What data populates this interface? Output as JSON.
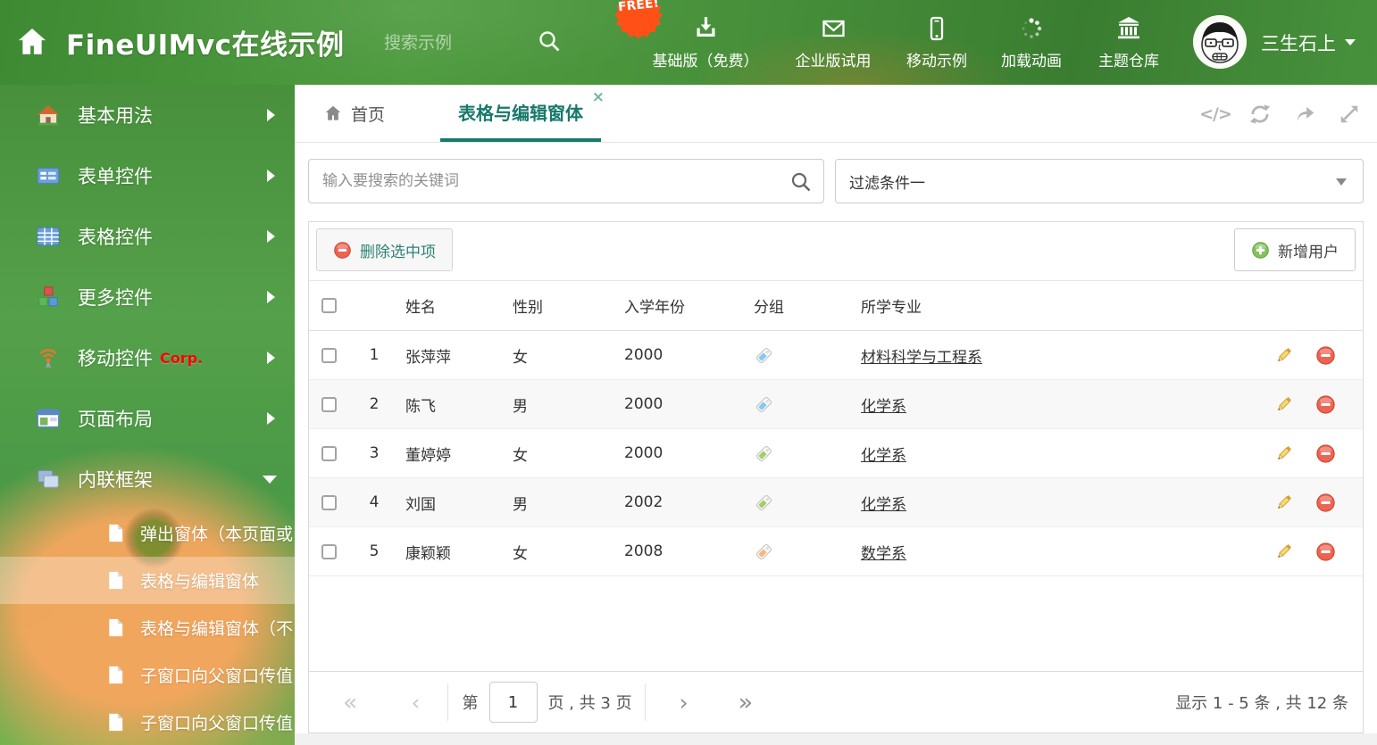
{
  "header": {
    "title": "FineUIMvc在线示例",
    "search_placeholder": "搜索示例",
    "free_badge": "FREE!",
    "nav": [
      {
        "label": "基础版（免费）"
      },
      {
        "label": "企业版试用"
      },
      {
        "label": "移动示例"
      },
      {
        "label": "加载动画"
      },
      {
        "label": "主题仓库"
      }
    ],
    "username": "三生石上"
  },
  "sidebar": {
    "items": [
      {
        "label": "基本用法"
      },
      {
        "label": "表单控件"
      },
      {
        "label": "表格控件"
      },
      {
        "label": "更多控件"
      },
      {
        "label": "移动控件",
        "badge": "Corp."
      },
      {
        "label": "页面布局"
      },
      {
        "label": "内联框架"
      }
    ],
    "subitems": [
      {
        "label": "弹出窗体（本页面或..."
      },
      {
        "label": "表格与编辑窗体"
      },
      {
        "label": "表格与编辑窗体（不..."
      },
      {
        "label": "子窗口向父窗口传值"
      },
      {
        "label": "子窗口向父窗口传值..."
      }
    ]
  },
  "tabs": {
    "home_label": "首页",
    "active_label": "表格与编辑窗体"
  },
  "filter": {
    "search_placeholder": "输入要搜索的关键词",
    "selected": "过滤条件一"
  },
  "grid_toolbar": {
    "delete_label": "删除选中项",
    "add_label": "新增用户"
  },
  "table": {
    "columns": {
      "name": "姓名",
      "gender": "性别",
      "year": "入学年份",
      "group": "分组",
      "major": "所学专业"
    },
    "rows": [
      {
        "index": "1",
        "name": "张萍萍",
        "gender": "女",
        "year": "2000",
        "tag_color": "#85C8F2",
        "major": "材料科学与工程系"
      },
      {
        "index": "2",
        "name": "陈飞",
        "gender": "男",
        "year": "2000",
        "tag_color": "#85C8F2",
        "major": "化学系"
      },
      {
        "index": "3",
        "name": "董婷婷",
        "gender": "女",
        "year": "2000",
        "tag_color": "#A5CE6B",
        "major": "化学系"
      },
      {
        "index": "4",
        "name": "刘国",
        "gender": "男",
        "year": "2002",
        "tag_color": "#A5CE6B",
        "major": "化学系"
      },
      {
        "index": "5",
        "name": "康颖颖",
        "gender": "女",
        "year": "2008",
        "tag_color": "#F9B97C",
        "major": "数学系"
      }
    ]
  },
  "pagination": {
    "page_prefix": "第",
    "page_value": "1",
    "page_suffix": "页 , 共 3 页",
    "summary": "显示 1 - 5 条 , 共 12 条"
  },
  "icons": {
    "close_glyph": "×",
    "code_glyph": "</>",
    "first_glyph": "«",
    "prev_glyph": "‹",
    "next_glyph": "›",
    "last_glyph": "»"
  },
  "colors": {
    "accent": "#17796A",
    "header_green": "#47903C",
    "corp_red": "#FF0000",
    "free_badge": "#FF5117",
    "delete_red": "#E9573F",
    "add_green": "#71B84E",
    "pencil_gold": "#F0C75A",
    "tag_blue": "#85C8F2",
    "tag_green": "#A5CE6B",
    "tag_orange": "#F9B97C"
  }
}
